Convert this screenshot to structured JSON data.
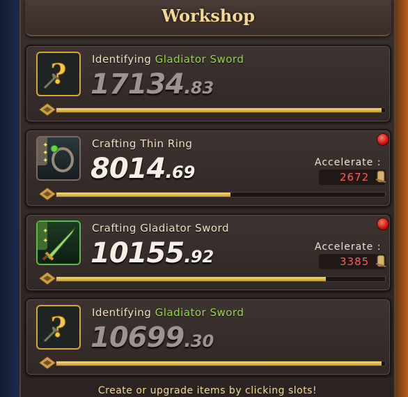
{
  "window": {
    "title": "Workshop"
  },
  "slots": [
    {
      "action": "Identifying",
      "item": "Gladiator Sword",
      "item_color": "#9ad84a",
      "timer_main": "17134",
      "timer_decimal": "83",
      "progress": 0.99,
      "icon": "question-mark-icon",
      "accelerate": null
    },
    {
      "action": "Crafting",
      "item": "Thin Ring",
      "item_color": "#f3e2c4",
      "timer_main": "8014",
      "timer_decimal": "69",
      "progress": 0.53,
      "icon": "ring-icon",
      "accelerate": {
        "label": "Accelerate :",
        "value": "2672"
      }
    },
    {
      "action": "Crafting",
      "item": "Gladiator Sword",
      "item_color": "#f3e2c4",
      "timer_main": "10155",
      "timer_decimal": "92",
      "progress": 0.82,
      "icon": "sword-icon",
      "accelerate": {
        "label": "Accelerate :",
        "value": "3385"
      }
    },
    {
      "action": "Identifying",
      "item": "Gladiator Sword",
      "item_color": "#9ad84a",
      "timer_main": "10699",
      "timer_decimal": "30",
      "progress": 0.99,
      "icon": "question-mark-icon",
      "accelerate": null
    }
  ],
  "footer": {
    "hint": "Create or upgrade items by clicking slots!"
  },
  "colors": {
    "progress": "#e8c45a",
    "accent": "#f3d79a",
    "alert": "#ff5a5a"
  }
}
